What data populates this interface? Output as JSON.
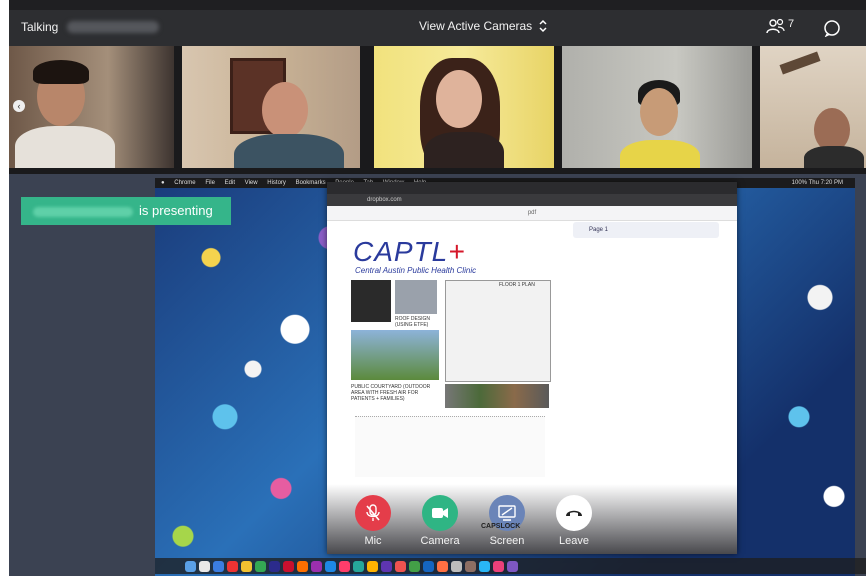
{
  "topbar": {
    "talking_label": "Talking",
    "view_selector": "View Active Cameras",
    "participant_count": "7"
  },
  "presenting": {
    "label": "is presenting"
  },
  "shared_screen": {
    "browser_url": "dropbox.com",
    "time": "Thu 7:20 PM",
    "battery": "100%",
    "doc_type": "pdf",
    "page_label": "Page 1",
    "brand_title": "CAPTL",
    "brand_plus": "+",
    "subtitle": "Central Austin Public Health Clinic",
    "caption_roof": "ROOF DESIGN (USING ETFE)",
    "caption_courtyard": "PUBLIC COURTYARD (OUTDOOR AREA WITH FRESH AIR FOR PATIENTS + FAMILIES)",
    "caption_floor": "FLOOR 1 PLAN",
    "menu": [
      "Chrome",
      "File",
      "Edit",
      "View",
      "History",
      "Bookmarks",
      "People",
      "Tab",
      "Window",
      "Help"
    ]
  },
  "controls": {
    "mic_label": "Mic",
    "camera_label": "Camera",
    "screen_label": "Screen",
    "leave_label": "Leave",
    "capslock": "CAPSLOCK"
  },
  "colors": {
    "present_banner": "#35b58a",
    "mic_red": "#e43d4a",
    "camera_green": "#2fb584",
    "screen_blue": "#6a84b8",
    "leave_white": "#ffffff"
  }
}
